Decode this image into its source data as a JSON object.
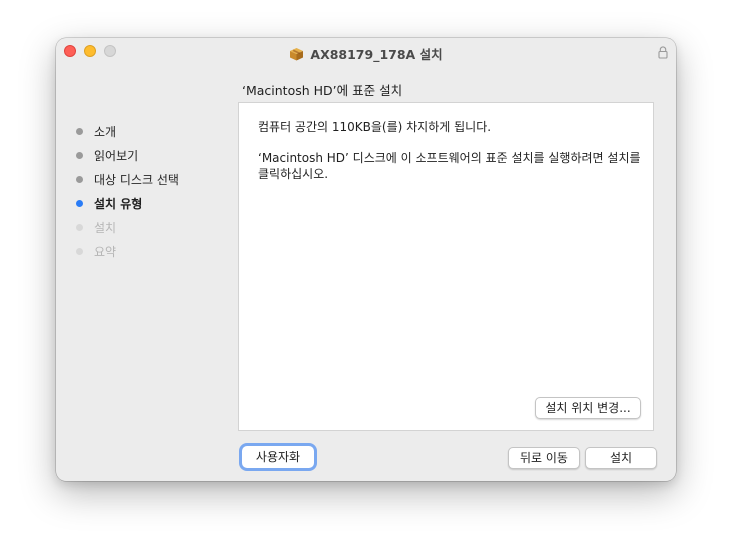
{
  "window": {
    "title": "AX88179_178A 설치",
    "title_icon": "package-icon",
    "lock_icon": "lock-icon"
  },
  "sidebar": {
    "steps": [
      {
        "label": "소개",
        "state": "done"
      },
      {
        "label": "읽어보기",
        "state": "done"
      },
      {
        "label": "대상 디스크 선택",
        "state": "done"
      },
      {
        "label": "설치 유형",
        "state": "active"
      },
      {
        "label": "설치",
        "state": "future"
      },
      {
        "label": "요약",
        "state": "future"
      }
    ]
  },
  "main": {
    "heading": "‘Macintosh HD’에 표준 설치",
    "paragraph1": "컴퓨터 공간의 110KB을(를) 차지하게 됩니다.",
    "paragraph2": "‘Macintosh HD’ 디스크에 이 소프트웨어의 표준 설치를 실행하려면 설치를 클릭하십시오.",
    "change_location_label": "설치 위치 변경..."
  },
  "footer": {
    "customize_label": "사용자화",
    "back_label": "뒤로 이동",
    "install_label": "설치"
  },
  "colors": {
    "active_step": "#2a7cf6",
    "focus_ring": "#7aa8f0",
    "close": "#fe5f57",
    "minimize": "#febc2e"
  }
}
